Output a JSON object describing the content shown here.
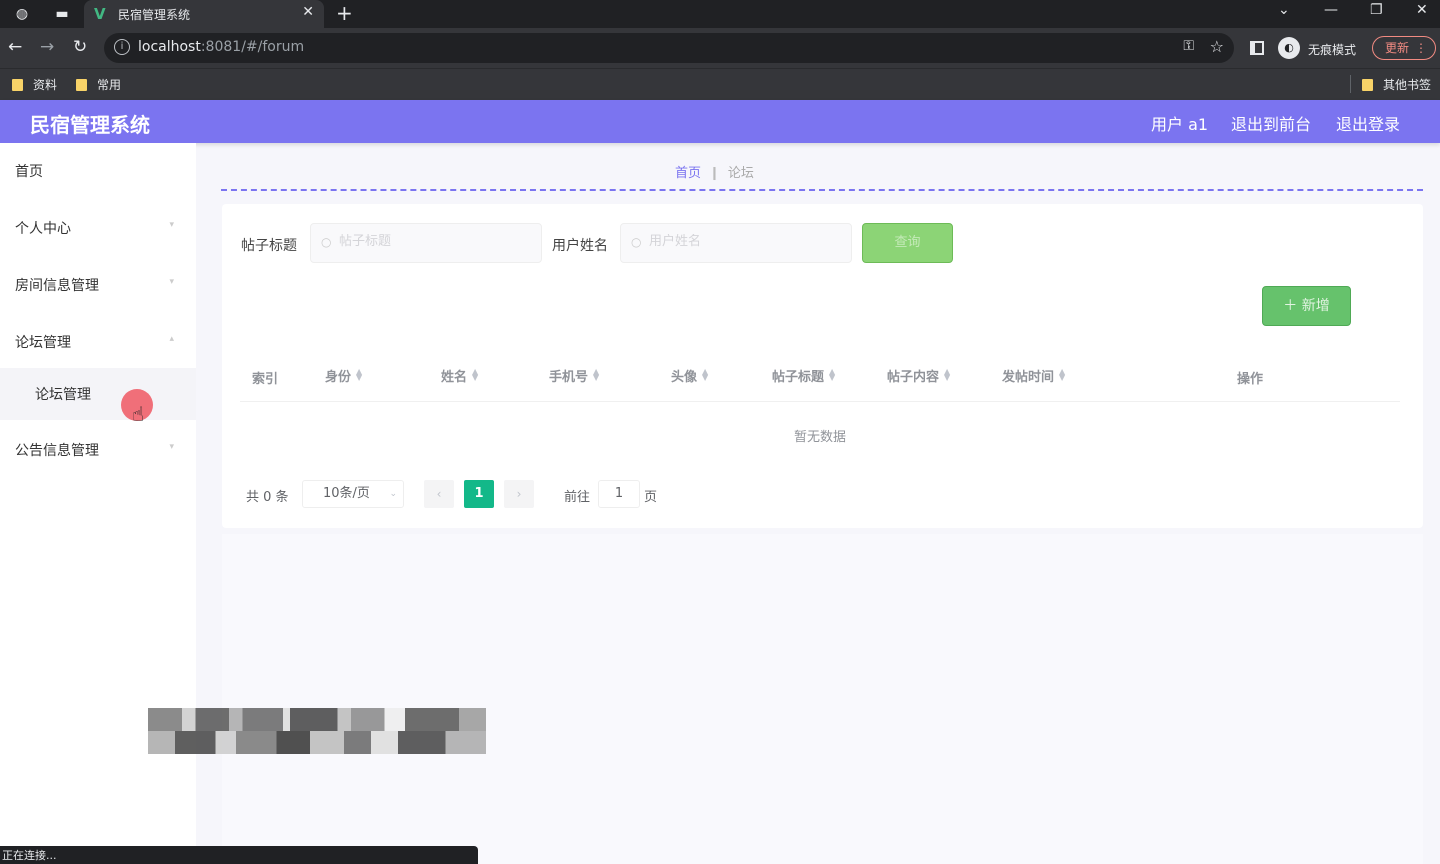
{
  "browser": {
    "tab_title": "民宿管理系统",
    "url_host": "localhost",
    "url_rest": ":8081/#/forum",
    "incognito_label": "无痕模式",
    "update_label": "更新",
    "bookmarks": [
      "资料",
      "常用"
    ],
    "other_bookmarks": "其他书签",
    "status_text": "正在连接..."
  },
  "header": {
    "title": "民宿管理系统",
    "user": "用户 a1",
    "back_front": "退出到前台",
    "logout": "退出登录",
    "color": "#7b74f0"
  },
  "sidebar": {
    "items": [
      {
        "label": "首页"
      },
      {
        "label": "个人中心"
      },
      {
        "label": "房间信息管理"
      },
      {
        "label": "论坛管理"
      },
      {
        "label": "公告信息管理"
      }
    ],
    "subitem": "论坛管理"
  },
  "breadcrumb": {
    "home": "首页",
    "current": "论坛"
  },
  "search": {
    "title_label": "帖子标题",
    "title_placeholder": "帖子标题",
    "user_label": "用户姓名",
    "user_placeholder": "用户姓名",
    "query_button": "查询",
    "add_button": "新增"
  },
  "table": {
    "columns": [
      "索引",
      "身份",
      "姓名",
      "手机号",
      "头像",
      "帖子标题",
      "帖子内容",
      "发帖时间",
      "操作"
    ],
    "empty_text": "暂无数据"
  },
  "pagination": {
    "total": "共 0 条",
    "page_size": "10条/页",
    "current_page": "1",
    "goto_label": "前往",
    "goto_value": "1",
    "page_suffix": "页",
    "active_color": "#13b889"
  }
}
